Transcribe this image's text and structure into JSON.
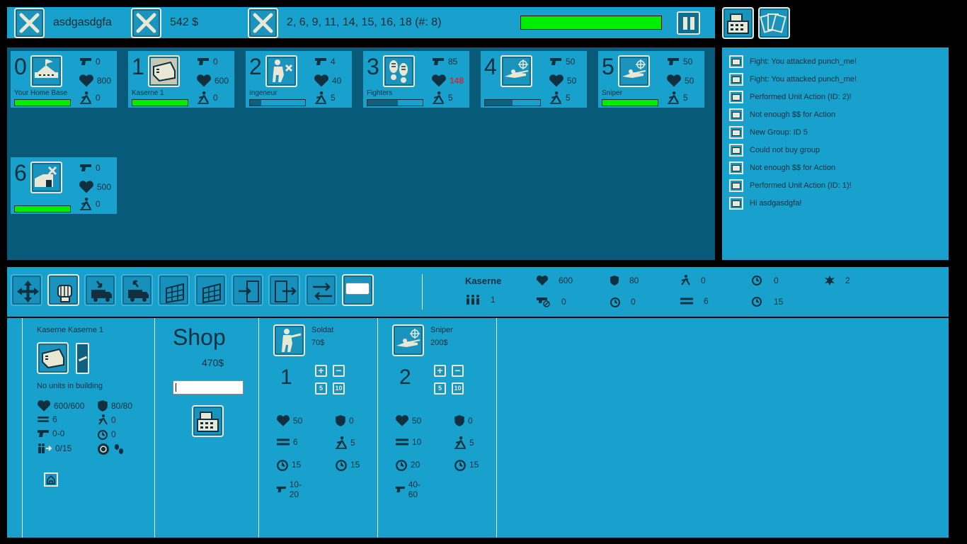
{
  "topbar": {
    "player": "asdgasdgfa",
    "money": "542 $",
    "groups": "2, 6, 9, 11, 14, 15, 16, 18  (#: 8)"
  },
  "cards": [
    {
      "num": "0",
      "name": "Your Home Base",
      "atk": "0",
      "hp": "800",
      "mv": "0",
      "icon": "home-base-icon",
      "bar_fill": 1.0,
      "bar_color": "#00ee00"
    },
    {
      "num": "1",
      "name": "Kaserne 1",
      "atk": "0",
      "hp": "600",
      "mv": "0",
      "icon": "barracks-icon",
      "bar_fill": 1.0,
      "bar_color": "#00ee00"
    },
    {
      "num": "2",
      "name": "Ingeneur",
      "atk": "4",
      "hp": "40",
      "mv": "5",
      "icon": "engineer-icon",
      "bar_fill": 0.2,
      "bar_color": "#0f5f80"
    },
    {
      "num": "3",
      "name": "Fighters",
      "atk": "85",
      "hp": "148",
      "mv": "5",
      "icon": "footprints-icon",
      "bar_fill": 0.55,
      "bar_color": "#0f5f80",
      "hp_red": true
    },
    {
      "num": "4",
      "name": "",
      "atk": "50",
      "hp": "50",
      "mv": "5",
      "icon": "sniper-icon",
      "bar_fill": 0.5,
      "bar_color": "#0f5f80"
    },
    {
      "num": "5",
      "name": "Sniper",
      "atk": "50",
      "hp": "50",
      "mv": "5",
      "icon": "sniper-icon",
      "bar_fill": 1.0,
      "bar_color": "#00ee00"
    },
    {
      "num": "6",
      "name": "",
      "atk": "0",
      "hp": "500",
      "mv": "0",
      "icon": "workshop-icon",
      "bar_fill": 1.0,
      "bar_color": "#00ee00"
    }
  ],
  "log": [
    "Fight: You attacked punch_me!",
    "Fight: You attacked punch_me!",
    "Performed Unit Action (ID: 2)!",
    "Not enough $$ for Action",
    "New Group: ID 5",
    "Could not buy group",
    "Not enough $$ for Action",
    "Performed Unit Action (ID: 1)!",
    "Hi asdgasdgfa!"
  ],
  "info": {
    "name": "Kaserne",
    "hp": "600",
    "armor": "80",
    "move": "0",
    "timer1": "0",
    "extra": "2",
    "units": "1",
    "noatk": "0",
    "time2": "0",
    "range": "6",
    "timer2": "15"
  },
  "building": {
    "title": "Kaserne Kaserne 1",
    "status": "No units in building",
    "hp": "600/600",
    "armor": "80/80",
    "range": "6",
    "move": "0",
    "atk": "0-0",
    "time": "0",
    "units": "0/15"
  },
  "shop": {
    "title": "Shop",
    "price": "470$"
  },
  "items": [
    {
      "name": "Soldat",
      "price": "70$",
      "count": "1",
      "hp": "50",
      "armor": "0",
      "range": "6",
      "move": "5",
      "t1": "15",
      "t2": "15",
      "atk": "10-20",
      "icon": "soldier-icon"
    },
    {
      "name": "Sniper",
      "price": "200$",
      "count": "2",
      "hp": "50",
      "armor": "0",
      "range": "10",
      "move": "5",
      "t1": "20",
      "t2": "15",
      "atk": "40-60",
      "icon": "sniper-icon"
    }
  ],
  "pm_labels": {
    "plus": "+",
    "minus": "−",
    "five": "5",
    "ten": "10"
  }
}
